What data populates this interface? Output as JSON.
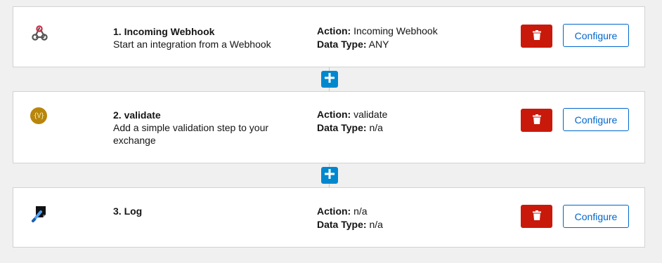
{
  "steps": [
    {
      "icon": "webhook-icon",
      "title": "1. Incoming Webhook",
      "description": "Start an integration from a Webhook",
      "action_label": "Action:",
      "action_value": "Incoming Webhook",
      "datatype_label": "Data Type:",
      "datatype_value": "ANY",
      "configure_label": "Configure"
    },
    {
      "icon": "validate-icon",
      "icon_text": "{V}",
      "title": "2. validate",
      "description": "Add a simple validation step to your exchange",
      "action_label": "Action:",
      "action_value": "validate",
      "datatype_label": "Data Type:",
      "datatype_value": "n/a",
      "configure_label": "Configure"
    },
    {
      "icon": "log-icon",
      "title": "3. Log",
      "description": "",
      "action_label": "Action:",
      "action_value": "n/a",
      "datatype_label": "Data Type:",
      "datatype_value": "n/a",
      "configure_label": "Configure"
    }
  ],
  "colors": {
    "delete": "#c9190b",
    "configure": "#0066cc",
    "add_step": "#0088ce",
    "background": "#f0f0f0"
  }
}
